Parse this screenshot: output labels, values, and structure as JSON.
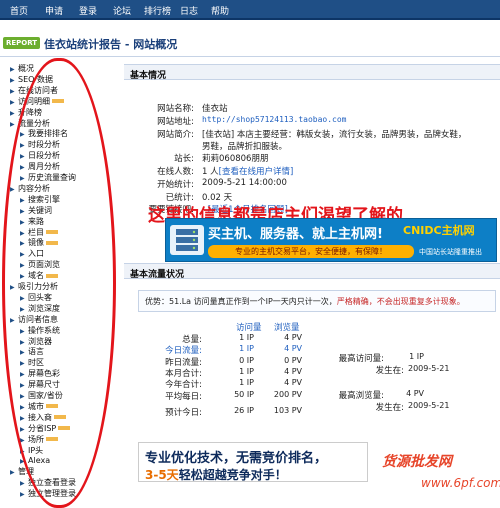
{
  "nav": [
    "首页",
    "申请",
    "登录",
    "论坛",
    "排行榜",
    "日志",
    "帮助"
  ],
  "header": {
    "badge": "REPORT",
    "title": "佳衣站统计报告 - 网站概况"
  },
  "sidebar": [
    {
      "label": "概况",
      "level": 0,
      "hl": false
    },
    {
      "label": "SEO 数据",
      "level": 0,
      "hl": false
    },
    {
      "label": "在线访问者",
      "level": 0,
      "hl": false
    },
    {
      "label": "访问明细",
      "level": 0,
      "hl": true
    },
    {
      "label": "升降榜",
      "level": 0,
      "hl": false
    },
    {
      "label": "流量分析",
      "level": 0,
      "hl": false
    },
    {
      "label": "我要排排名",
      "level": 1,
      "hl": false
    },
    {
      "label": "时段分析",
      "level": 1,
      "hl": false
    },
    {
      "label": "日段分析",
      "level": 1,
      "hl": false
    },
    {
      "label": "周月分析",
      "level": 1,
      "hl": false
    },
    {
      "label": "历史流量查询",
      "level": 1,
      "hl": false
    },
    {
      "label": "内容分析",
      "level": 0,
      "hl": false
    },
    {
      "label": "搜索引擎",
      "level": 1,
      "hl": false
    },
    {
      "label": "关键词",
      "level": 1,
      "hl": false
    },
    {
      "label": "来路",
      "level": 1,
      "hl": false
    },
    {
      "label": "栏目",
      "level": 1,
      "hl": true
    },
    {
      "label": "镜像",
      "level": 1,
      "hl": true
    },
    {
      "label": "入口",
      "level": 1,
      "hl": false
    },
    {
      "label": "页面浏览",
      "level": 1,
      "hl": false
    },
    {
      "label": "域名",
      "level": 1,
      "hl": true
    },
    {
      "label": "吸引力分析",
      "level": 0,
      "hl": false
    },
    {
      "label": "回头客",
      "level": 1,
      "hl": false
    },
    {
      "label": "浏览深度",
      "level": 1,
      "hl": false
    },
    {
      "label": "访问者信息",
      "level": 0,
      "hl": false
    },
    {
      "label": "操作系统",
      "level": 1,
      "hl": false
    },
    {
      "label": "浏览器",
      "level": 1,
      "hl": false
    },
    {
      "label": "语言",
      "level": 1,
      "hl": false
    },
    {
      "label": "时区",
      "level": 1,
      "hl": false
    },
    {
      "label": "屏幕色彩",
      "level": 1,
      "hl": false
    },
    {
      "label": "屏幕尺寸",
      "level": 1,
      "hl": false
    },
    {
      "label": "国家/省份",
      "level": 1,
      "hl": false
    },
    {
      "label": "城市",
      "level": 1,
      "hl": true
    },
    {
      "label": "接入商",
      "level": 1,
      "hl": true
    },
    {
      "label": "分省ISP",
      "level": 1,
      "hl": true
    },
    {
      "label": "场所",
      "level": 1,
      "hl": true
    },
    {
      "label": "IP头",
      "level": 1,
      "hl": false
    },
    {
      "label": "Alexa",
      "level": 1,
      "hl": false
    },
    {
      "label": "管理",
      "level": 0,
      "hl": false
    },
    {
      "label": "独立查看登录",
      "level": 1,
      "hl": false
    },
    {
      "label": "独立管理登录",
      "level": 1,
      "hl": false
    }
  ],
  "basic": {
    "section_title": "基本情况",
    "rows": [
      {
        "label": "网站名称:",
        "value": "佳衣站",
        "link": false,
        "mono": false
      },
      {
        "label": "网站地址:",
        "value": "http://shop57124113.taobao.com",
        "link": true,
        "mono": true
      },
      {
        "label": "网站简介:",
        "value": "[佳衣站] 本店主要经营：韩版女装，流行女装，品牌男装，品牌女鞋，",
        "link": false,
        "mono": false
      },
      {
        "label": "",
        "value": "男鞋，品牌折扣服装。",
        "link": false,
        "mono": false
      },
      {
        "label": "站长:",
        "value": "莉莉060806朋朋",
        "link": false,
        "mono": false
      },
      {
        "label": "在线人数:",
        "value": "1 人",
        "extra": "[查看在线用户详情]",
        "link": false,
        "mono": false
      },
      {
        "label": "开始统计:",
        "value": "2009-5-21 14:00:00",
        "link": false,
        "mono": false
      },
      {
        "label": "已统计:",
        "value": "0.02 天",
        "link": false,
        "mono": false
      },
      {
        "label": "要要链接吧:",
        "value": "- ",
        "extra": "[最近1个月排名回顾]",
        "link": false,
        "mono": false
      }
    ]
  },
  "overlay_text": "这里的信息都是店主们渴望了解的",
  "ad1": {
    "headline": "买主机、服务器、就上主机网!",
    "brand": "CNIDC主机网",
    "sub": "专业的主机交易平台，安全便捷，有保障！",
    "sub2": "中国站长站隆重推出"
  },
  "traffic": {
    "section_title": "基本流量状况",
    "note_prefix": "优势：51.La 访问量真正作到一个IP一天内只计一次，",
    "note_warn": "严格精确，不会出现重复多计现象。",
    "col_visits": "访问量",
    "col_views": "浏览量",
    "rows": [
      {
        "label": "总量:",
        "visits": "1 IP",
        "views": "4 PV",
        "today": false
      },
      {
        "label": "今日流量:",
        "visits": "1 IP",
        "views": "4 PV",
        "today": true
      },
      {
        "label": "昨日流量:",
        "visits": "0 IP",
        "views": "0 PV",
        "today": false
      },
      {
        "label": "本月合计:",
        "visits": "1 IP",
        "views": "4 PV",
        "today": false
      },
      {
        "label": "今年合计:",
        "visits": "1 IP",
        "views": "4 PV",
        "today": false
      },
      {
        "label": "平均每日:",
        "visits": "50 IP",
        "views": "200 PV",
        "today": false
      },
      {
        "label": "预计今日:",
        "visits": "26 IP",
        "views": "103 PV",
        "today": false
      }
    ],
    "max_visits_label": "最高访问量:",
    "max_visits_value": "1 IP",
    "max_visits_time_label": "发生在:",
    "max_visits_time": "2009-5-21",
    "max_views_label": "最高浏览量:",
    "max_views_value": "4 PV",
    "max_views_time_label": "发生在:",
    "max_views_time": "2009-5-21"
  },
  "ad2": {
    "line1": "专业优化技术，无需竞价排名，",
    "line2_a": "3-5天",
    "line2_b": "轻松超越竞争对手！"
  },
  "watermark": {
    "line1": "货源批发网",
    "line2": "www.6pf.com"
  }
}
